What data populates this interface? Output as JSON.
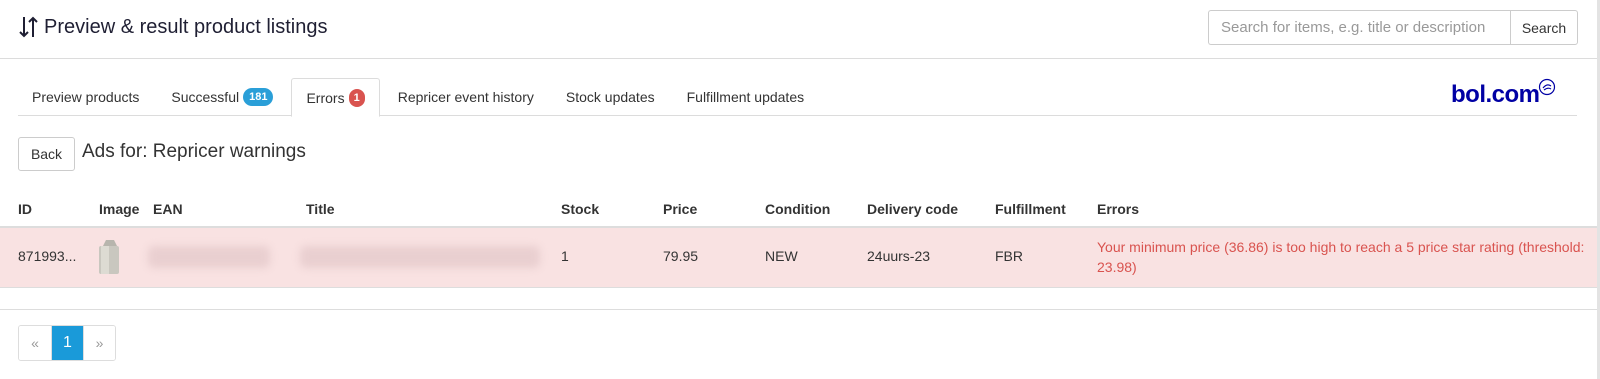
{
  "header": {
    "title": "Preview & result product listings",
    "search_placeholder": "Search for items, e.g. title or description",
    "search_value": "",
    "search_button": "Search"
  },
  "tabs": [
    {
      "label": "Preview products",
      "badge": null,
      "active": false
    },
    {
      "label": "Successful",
      "badge": "181",
      "active": false
    },
    {
      "label": "Errors",
      "badge": "1",
      "active": true
    },
    {
      "label": "Repricer event history",
      "badge": null,
      "active": false
    },
    {
      "label": "Stock updates",
      "badge": null,
      "active": false
    },
    {
      "label": "Fulfillment updates",
      "badge": null,
      "active": false
    }
  ],
  "logo": "bol.com",
  "back_button": "Back",
  "section_title": "Ads for: Repricer warnings",
  "table": {
    "columns": [
      "ID",
      "Image",
      "EAN",
      "Title",
      "Stock",
      "Price",
      "Condition",
      "Delivery code",
      "Fulfillment",
      "Errors"
    ],
    "rows": [
      {
        "id": "871993...",
        "ean": "",
        "title": "",
        "stock": "1",
        "price": "79.95",
        "condition": "NEW",
        "delivery_code": "24uurs-23",
        "fulfillment": "FBR",
        "error": "Your minimum price (36.86) is too high to reach a 5 price star rating (threshold: 23.98)"
      }
    ]
  },
  "pagination": {
    "prev": "«",
    "current": "1",
    "next": "»"
  },
  "colors": {
    "accent_blue": "#1a9ad9",
    "error_red": "#d9534f",
    "error_row_bg": "#f9e2e2",
    "logo_blue": "#0000a4"
  },
  "icons": {
    "title_icon": "sort-arrows-icon",
    "logo_mark": "smile-mark-icon"
  }
}
